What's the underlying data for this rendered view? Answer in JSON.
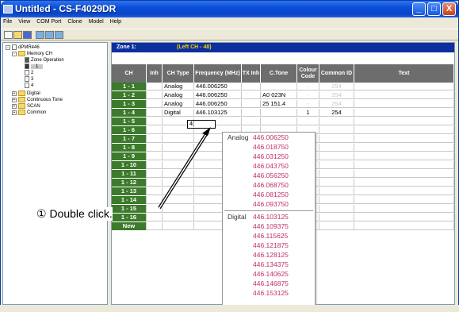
{
  "window": {
    "title": "Untitled - CS-F4029DR",
    "min": "_",
    "max": "□",
    "close": "X"
  },
  "menu": [
    "File",
    "View",
    "COM Port",
    "Clone",
    "Model",
    "Help"
  ],
  "tree": {
    "root": "dPMR446",
    "memory_ch": "Memory CH",
    "zone_operation": "Zone Operation",
    "zones": [
      "1",
      "2",
      "3",
      "4"
    ],
    "digital": "Digital",
    "continuous_tone": "Continuous Tone",
    "scan": "SCAN",
    "common": "Common"
  },
  "zone_bar": {
    "zone": "Zone 1:",
    "left": "(Left CH - 48)"
  },
  "table": {
    "headers": [
      "CH",
      "Inh",
      "CH Type",
      "Frequency (MHz)",
      "TX Inh",
      "C.Tone",
      "Colour Code",
      "Common ID",
      "Text"
    ],
    "rows": [
      {
        "ch": "1 - 1",
        "type": "Analog",
        "freq": "446.006250",
        "ctone": "",
        "colour": "-",
        "common": "254"
      },
      {
        "ch": "1 - 2",
        "type": "Analog",
        "freq": "446.006250",
        "ctone": "A0 023N",
        "colour": "-",
        "common": "254"
      },
      {
        "ch": "1 - 3",
        "type": "Analog",
        "freq": "446.006250",
        "ctone": "25 151.4",
        "colour": "-",
        "common": "254"
      },
      {
        "ch": "1 - 4",
        "type": "Digital",
        "freq": "446.103125",
        "ctone": "",
        "colour": "1",
        "common": "254"
      },
      {
        "ch": "1 - 5",
        "type": "",
        "freq": "",
        "ctone": "",
        "colour": "",
        "common": ""
      },
      {
        "ch": "1 - 6",
        "type": "",
        "freq": "",
        "ctone": "",
        "colour": "",
        "common": ""
      },
      {
        "ch": "1 - 7",
        "type": "",
        "freq": "",
        "ctone": "",
        "colour": "",
        "common": ""
      },
      {
        "ch": "1 - 8",
        "type": "",
        "freq": "",
        "ctone": "",
        "colour": "",
        "common": ""
      },
      {
        "ch": "1 - 9",
        "type": "",
        "freq": "",
        "ctone": "",
        "colour": "",
        "common": ""
      },
      {
        "ch": "1 - 10",
        "type": "",
        "freq": "",
        "ctone": "",
        "colour": "",
        "common": ""
      },
      {
        "ch": "1 - 11",
        "type": "",
        "freq": "",
        "ctone": "",
        "colour": "",
        "common": ""
      },
      {
        "ch": "1 - 12",
        "type": "",
        "freq": "",
        "ctone": "",
        "colour": "",
        "common": ""
      },
      {
        "ch": "1 - 13",
        "type": "",
        "freq": "",
        "ctone": "",
        "colour": "",
        "common": ""
      },
      {
        "ch": "1 - 14",
        "type": "",
        "freq": "",
        "ctone": "",
        "colour": "",
        "common": ""
      },
      {
        "ch": "1 - 15",
        "type": "",
        "freq": "",
        "ctone": "",
        "colour": "",
        "common": ""
      },
      {
        "ch": "1 - 16",
        "type": "",
        "freq": "",
        "ctone": "",
        "colour": "",
        "common": ""
      },
      {
        "ch": "New",
        "type": "",
        "freq": "",
        "ctone": "",
        "colour": "",
        "common": ""
      }
    ],
    "edit_value": "4("
  },
  "popup": {
    "analog_label": "Analog",
    "digital_label": "Digital",
    "analog": [
      "446.006250",
      "446.018750",
      "446.031250",
      "446.043750",
      "446.056250",
      "446.068750",
      "446.081250",
      "446.093750"
    ],
    "digital": [
      "446.103125",
      "446.109375",
      "446.115625",
      "446.121875",
      "446.128125",
      "446.134375",
      "446.140625",
      "446.146875",
      "446.153125"
    ]
  },
  "annotation": "① Double click.",
  "colors": {
    "accent": "#0d2f9e",
    "ch_cell": "#3c7a2c",
    "freq_text": "#c0306a"
  }
}
